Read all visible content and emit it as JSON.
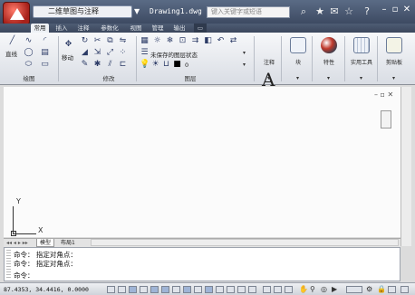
{
  "app": {
    "workspace": "二维草图与注释",
    "document_title": "Drawing1.dwg",
    "search_placeholder": "键入关键字或短语"
  },
  "ribbon": {
    "tabs": [
      {
        "label": "常用",
        "active": true
      },
      {
        "label": "插入",
        "active": false
      },
      {
        "label": "注释",
        "active": false
      },
      {
        "label": "参数化",
        "active": false
      },
      {
        "label": "视图",
        "active": false
      },
      {
        "label": "管理",
        "active": false
      },
      {
        "label": "输出",
        "active": false
      }
    ],
    "panels": {
      "draw": "绘图",
      "modify": "修改",
      "layers": "图层",
      "annotation": "注释",
      "block": "块",
      "properties": "特性",
      "utilities": "实用工具",
      "clipboard": "剪贴板"
    },
    "tool_labels": {
      "line": "直线",
      "move": "移动",
      "layer_state": "未保存的图层状态"
    },
    "layer_value": "0"
  },
  "drawing": {
    "ucs_x": "X",
    "ucs_y": "Y"
  },
  "layout_tabs": [
    {
      "label": "模型",
      "active": true
    },
    {
      "label": "布局1",
      "active": false
    }
  ],
  "command": {
    "lines": [
      "命令： 指定对角点：",
      "命令： 指定对角点：",
      "命令："
    ]
  },
  "status": {
    "coordinates": "87.4353, 34.4416, 0.0000"
  },
  "colors": {
    "title_bar": "#3d4a62",
    "app_button": "#a8221b",
    "canvas": "#fbfbfb"
  }
}
